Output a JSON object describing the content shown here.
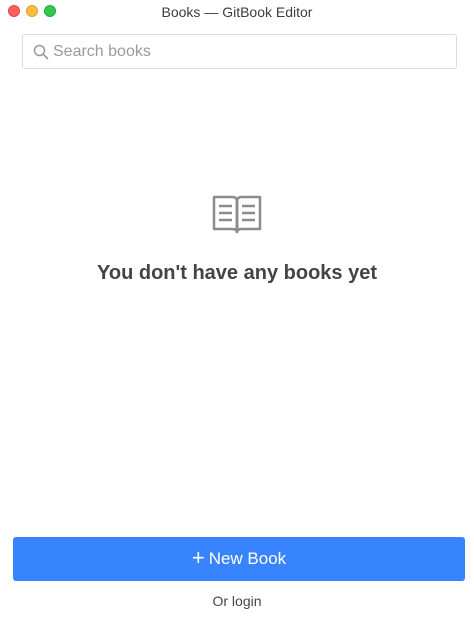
{
  "window": {
    "title": "Books — GitBook Editor"
  },
  "search": {
    "placeholder": "Search books"
  },
  "empty_state": {
    "icon": "open-book-icon",
    "message": "You don't have any books yet"
  },
  "actions": {
    "new_book_label": "New Book",
    "login_label": "Or login"
  },
  "colors": {
    "primary": "#3884ff",
    "close": "#fc605c",
    "minimize": "#fdbc40",
    "maximize": "#34c84a"
  }
}
